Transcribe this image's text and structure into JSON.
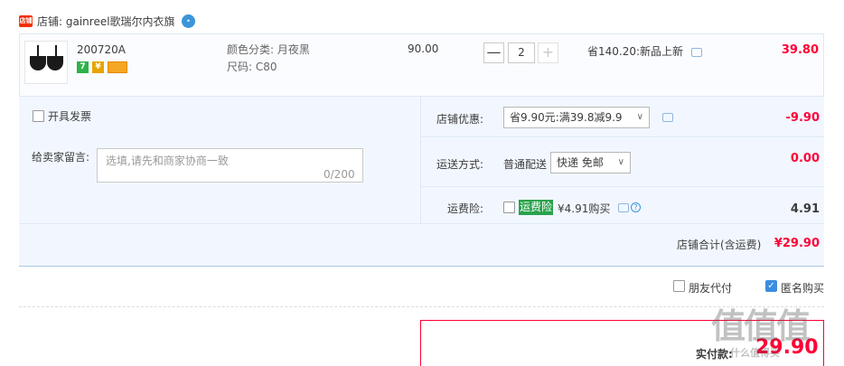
{
  "shop": {
    "label": "店铺:",
    "name": "gainreel歌瑞尔内衣旗",
    "icon_text": "店铺",
    "badge_icon_text": "•"
  },
  "item": {
    "sku": "200720A",
    "tags": [
      "7",
      "¥",
      "▬"
    ],
    "color_label": "颜色分类:",
    "color_value": "月夜黑",
    "size_label": "尺码:",
    "size_value": "C80",
    "unit_price": "90.00",
    "qty_minus": "—",
    "quantity": "2",
    "qty_plus": "+",
    "promo": "省140.20:新品上新",
    "subtotal": "39.80"
  },
  "invoice": {
    "label": "开具发票"
  },
  "message": {
    "label": "给卖家留言:",
    "placeholder": "选填,请先和商家协商一致",
    "count": "0/200"
  },
  "discount": {
    "label": "店铺优惠:",
    "selected": "省9.90元:满39.8减9.9",
    "value": "-9.90"
  },
  "shipping": {
    "label": "运送方式:",
    "method": "普通配送",
    "selected": "快递 免邮",
    "value": "0.00"
  },
  "insurance": {
    "label": "运费险:",
    "tag": "运费险",
    "text": "¥4.91购买",
    "value": "4.91"
  },
  "shop_total": {
    "label": "店铺合计(含运费)",
    "value": "¥29.90"
  },
  "options": {
    "friend_pay": "朋友代付",
    "anonymous": "匿名购买"
  },
  "payment": {
    "label": "实付款:",
    "value": "29.90"
  },
  "watermark": {
    "logo": "值值值",
    "url": "什么值得买"
  },
  "colors": {
    "accent_red": "#ff0036",
    "link_blue": "#3b8de0",
    "panel_bg": "#f2f7ff"
  }
}
